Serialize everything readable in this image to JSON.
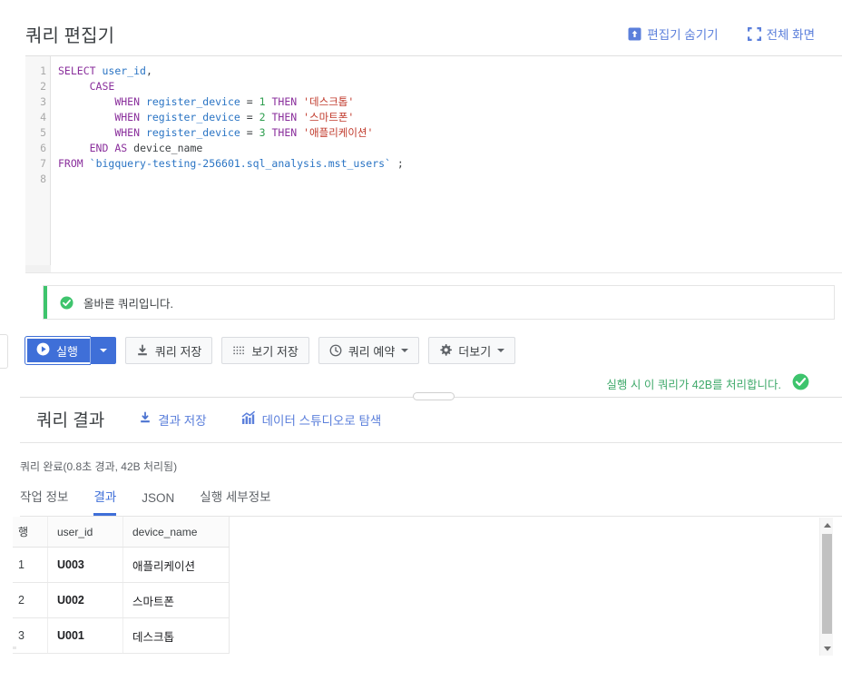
{
  "editor": {
    "title": "쿼리 편집기",
    "actions": [
      {
        "label": "편집기 숨기기",
        "icon": "hide-editor-icon"
      },
      {
        "label": "전체 화면",
        "icon": "fullscreen-icon"
      }
    ],
    "line_numbers": [
      "1",
      "2",
      "3",
      "4",
      "5",
      "6",
      "7",
      "8"
    ],
    "code_lines": [
      {
        "n": "1",
        "tokens": [
          {
            "t": "SELECT",
            "c": "kw"
          },
          {
            "t": " ",
            "c": "pl"
          },
          {
            "t": "user_id",
            "c": "id"
          },
          {
            "t": ",",
            "c": "pl"
          }
        ]
      },
      {
        "n": "2",
        "tokens": [
          {
            "t": "     ",
            "c": "pl"
          },
          {
            "t": "CASE",
            "c": "kw"
          }
        ]
      },
      {
        "n": "3",
        "tokens": [
          {
            "t": "         ",
            "c": "pl"
          },
          {
            "t": "WHEN",
            "c": "kw"
          },
          {
            "t": " ",
            "c": "pl"
          },
          {
            "t": "register_device",
            "c": "id"
          },
          {
            "t": " = ",
            "c": "pl"
          },
          {
            "t": "1",
            "c": "num"
          },
          {
            "t": " ",
            "c": "pl"
          },
          {
            "t": "THEN",
            "c": "kw"
          },
          {
            "t": " ",
            "c": "pl"
          },
          {
            "t": "'데스크톱'",
            "c": "str"
          }
        ]
      },
      {
        "n": "4",
        "tokens": [
          {
            "t": "         ",
            "c": "pl"
          },
          {
            "t": "WHEN",
            "c": "kw"
          },
          {
            "t": " ",
            "c": "pl"
          },
          {
            "t": "register_device",
            "c": "id"
          },
          {
            "t": " = ",
            "c": "pl"
          },
          {
            "t": "2",
            "c": "num"
          },
          {
            "t": " ",
            "c": "pl"
          },
          {
            "t": "THEN",
            "c": "kw"
          },
          {
            "t": " ",
            "c": "pl"
          },
          {
            "t": "'스마트폰'",
            "c": "str"
          }
        ]
      },
      {
        "n": "5",
        "tokens": [
          {
            "t": "         ",
            "c": "pl"
          },
          {
            "t": "WHEN",
            "c": "kw"
          },
          {
            "t": " ",
            "c": "pl"
          },
          {
            "t": "register_device",
            "c": "id"
          },
          {
            "t": " = ",
            "c": "pl"
          },
          {
            "t": "3",
            "c": "num"
          },
          {
            "t": " ",
            "c": "pl"
          },
          {
            "t": "THEN",
            "c": "kw"
          },
          {
            "t": " ",
            "c": "pl"
          },
          {
            "t": "'애플리케이션'",
            "c": "str"
          }
        ]
      },
      {
        "n": "6",
        "tokens": [
          {
            "t": "     ",
            "c": "pl"
          },
          {
            "t": "END",
            "c": "kw"
          },
          {
            "t": " ",
            "c": "pl"
          },
          {
            "t": "AS",
            "c": "kw"
          },
          {
            "t": " ",
            "c": "pl"
          },
          {
            "t": "device_name",
            "c": "pl"
          }
        ]
      },
      {
        "n": "7",
        "tokens": [
          {
            "t": "FROM",
            "c": "kw"
          },
          {
            "t": " ",
            "c": "pl"
          },
          {
            "t": "`bigquery-testing-256601.sql_analysis.mst_users`",
            "c": "id"
          },
          {
            "t": " ;",
            "c": "pl"
          }
        ]
      },
      {
        "n": "8",
        "tokens": []
      }
    ]
  },
  "validation": {
    "message": "올바른 쿼리입니다.",
    "icon": "check-circle-icon",
    "accent_color": "#3ec46d"
  },
  "toolbar": {
    "run_label": "실행",
    "run_icon": "play-icon",
    "run_color": "#3f6fd8",
    "buttons": [
      {
        "label": "쿼리 저장",
        "icon": "save-download-icon",
        "caret": false
      },
      {
        "label": "보기 저장",
        "icon": "grid-dots-icon",
        "caret": false
      },
      {
        "label": "쿼리 예약",
        "icon": "clock-icon",
        "caret": true
      },
      {
        "label": "더보기",
        "icon": "gear-icon",
        "caret": true
      }
    ]
  },
  "process_note": {
    "text": "실행 시 이 쿼리가 42B를 처리합니다.",
    "icon": "check-circle-icon",
    "color": "#3ea96a"
  },
  "results": {
    "title": "쿼리 결과",
    "actions": [
      {
        "label": "결과 저장",
        "icon": "save-download-icon"
      },
      {
        "label": "데이터 스튜디오로 탐색",
        "icon": "bar-chart-icon"
      }
    ],
    "status": "쿼리 완료(0.8초 경과, 42B 처리됨)",
    "tabs": [
      {
        "label": "작업 정보",
        "active": false
      },
      {
        "label": "결과",
        "active": true
      },
      {
        "label": "JSON",
        "active": false
      },
      {
        "label": "실행 세부정보",
        "active": false
      }
    ],
    "table": {
      "columns": [
        "행",
        "user_id",
        "device_name"
      ],
      "rows": [
        [
          "1",
          "U003",
          "애플리케이션"
        ],
        [
          "2",
          "U002",
          "스마트폰"
        ],
        [
          "3",
          "U001",
          "데스크톱"
        ]
      ]
    }
  }
}
